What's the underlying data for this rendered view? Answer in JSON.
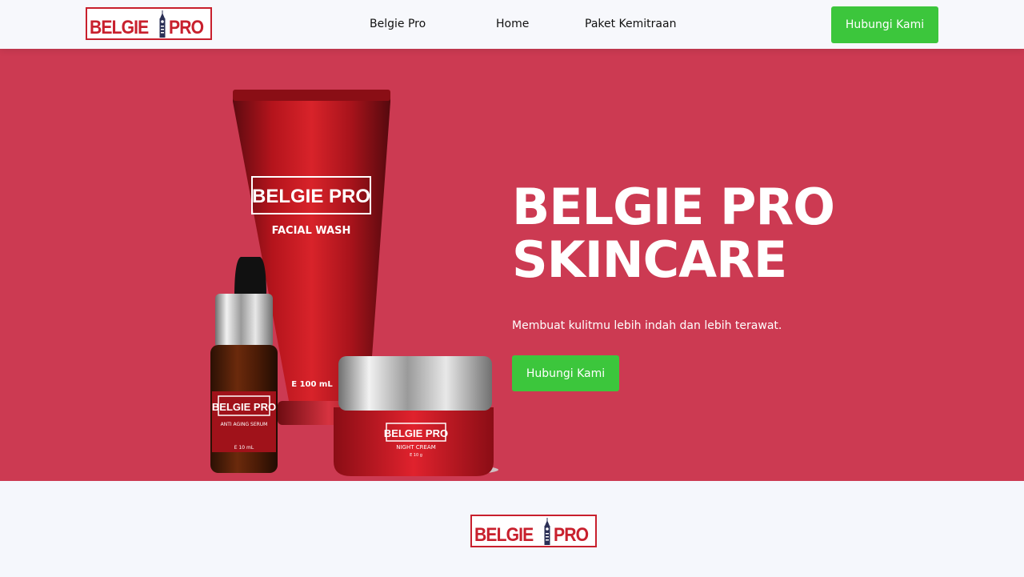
{
  "header": {
    "logo_text_left": "BELGIE",
    "logo_text_right": "PRO",
    "nav": [
      {
        "label": "Belgie Pro"
      },
      {
        "label": "Home"
      },
      {
        "label": "Paket Kemitraan"
      }
    ],
    "cta_label": "Hubungi Kami"
  },
  "hero": {
    "title_line1": "BELGIE PRO",
    "title_line2": "SKINCARE",
    "subtitle": "Membuat kulitmu lebih indah dan lebih terawat.",
    "cta_label": "Hubungi Kami",
    "background_color": "#cc3a52",
    "products": {
      "tube_brand": "BELGIE PRO",
      "tube_name": "FACIAL WASH",
      "tube_volume": "E 100 mL",
      "serum_brand": "BELGIE PRO",
      "serum_name": "ANTI AGING SERUM",
      "serum_volume": "E 10 mL",
      "jar_brand": "BELGIE PRO",
      "jar_name": "NIGHT CREAM",
      "jar_volume": "E 10 g"
    }
  },
  "footer": {
    "logo_text_left": "BELGIE",
    "logo_text_right": "PRO"
  },
  "colors": {
    "brand_red": "#c8202d",
    "accent_green": "#3cc63c",
    "hero_bg": "#cc3a52"
  }
}
